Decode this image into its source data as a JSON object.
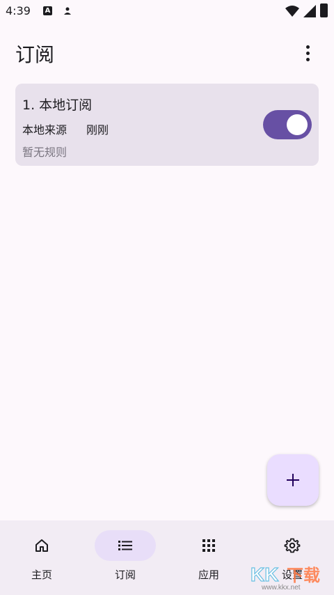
{
  "status_bar": {
    "time": "4:39",
    "icons": [
      "notification-a-icon",
      "person-icon",
      "wifi-icon",
      "signal-icon",
      "battery-icon"
    ]
  },
  "app_bar": {
    "title": "订阅",
    "menu_icon": "more-vert-icon"
  },
  "subscriptions": [
    {
      "title": "1. 本地订阅",
      "source": "本地来源",
      "updated": "刚刚",
      "rule": "暂无规则",
      "enabled": true
    }
  ],
  "fab": {
    "icon": "add-icon"
  },
  "bottom_nav": [
    {
      "label": "主页",
      "icon": "home-icon",
      "active": false
    },
    {
      "label": "订阅",
      "icon": "list-icon",
      "active": true
    },
    {
      "label": "应用",
      "icon": "apps-grid-icon",
      "active": false
    },
    {
      "label": "设置",
      "icon": "settings-icon",
      "active": false
    }
  ],
  "watermark": {
    "text": "KK下载",
    "url": "www.kkx.net"
  },
  "colors": {
    "background": "#fdf8fc",
    "card": "#e8e1ec",
    "accent": "#6750a4",
    "fab": "#eaddff",
    "nav_bar": "#f2ecf4",
    "nav_active_pill": "#e8def8"
  }
}
